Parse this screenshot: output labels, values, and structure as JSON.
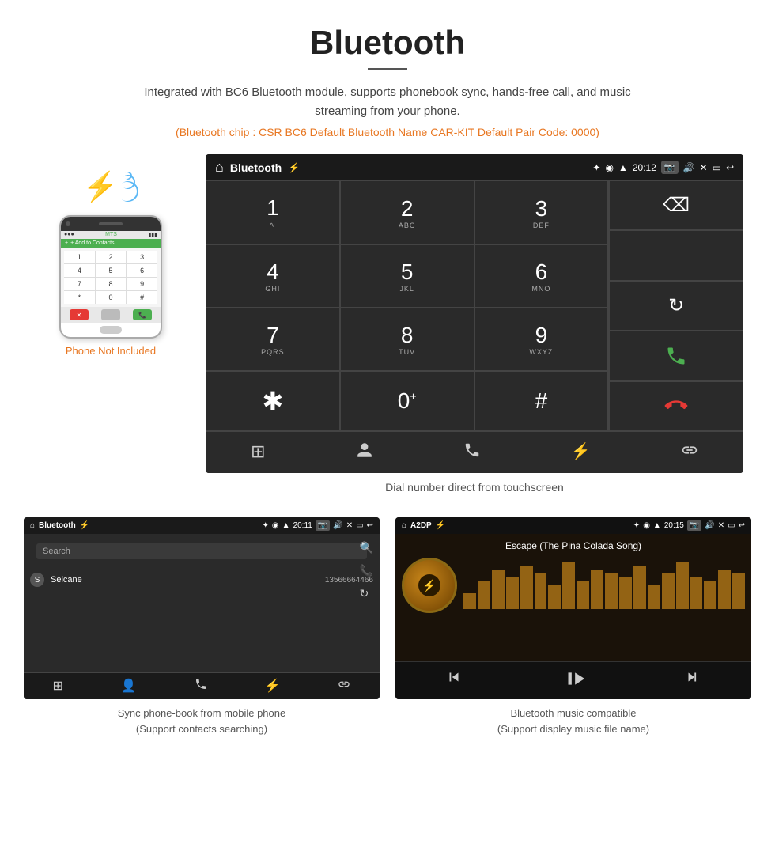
{
  "header": {
    "title": "Bluetooth",
    "description": "Integrated with BC6 Bluetooth module, supports phonebook sync, hands-free call, and music streaming from your phone.",
    "specs": "(Bluetooth chip : CSR BC6    Default Bluetooth Name CAR-KIT    Default Pair Code: 0000)"
  },
  "dial_screen": {
    "status_bar": {
      "home_icon": "⌂",
      "title": "Bluetooth",
      "usb_icon": "⚡",
      "bt_icon": "✦",
      "location_icon": "◉",
      "signal_icon": "▲",
      "time": "20:12",
      "camera_icon": "📷",
      "volume_icon": "🔊",
      "close_icon": "✕",
      "window_icon": "▭",
      "back_icon": "↩"
    },
    "keypad": [
      {
        "number": "1",
        "sub": "∿"
      },
      {
        "number": "2",
        "sub": "ABC"
      },
      {
        "number": "3",
        "sub": "DEF"
      },
      {
        "number": "4",
        "sub": "GHI"
      },
      {
        "number": "5",
        "sub": "JKL"
      },
      {
        "number": "6",
        "sub": "MNO"
      },
      {
        "number": "7",
        "sub": "PQRS"
      },
      {
        "number": "8",
        "sub": "TUV"
      },
      {
        "number": "9",
        "sub": "WXYZ"
      },
      {
        "number": "*",
        "sub": ""
      },
      {
        "number": "0",
        "sub": "+"
      },
      {
        "number": "#",
        "sub": ""
      }
    ],
    "right_panel": {
      "backspace": "⌫",
      "refresh": "↻",
      "call_green": "📞",
      "call_red": "📞"
    },
    "bottom_bar": {
      "grid_icon": "⊞",
      "person_icon": "👤",
      "phone_icon": "📞",
      "bt_icon": "✦",
      "link_icon": "🔗"
    }
  },
  "dial_caption": "Dial number direct from touchscreen",
  "phone": {
    "not_included": "Phone Not Included",
    "add_contact": "+ Add to Contacts",
    "keys": [
      "1",
      "2",
      "3",
      "4",
      "5",
      "6",
      "7",
      "8",
      "9",
      "*",
      "0",
      "#"
    ]
  },
  "phonebook_screen": {
    "title": "Bluetooth",
    "time": "20:11",
    "search_placeholder": "Search",
    "contact": {
      "letter": "S",
      "name": "Seicane",
      "phone": "13566664466"
    }
  },
  "music_screen": {
    "title": "A2DP",
    "time": "20:15",
    "song_title": "Escape (The Pina Colada Song)",
    "eq_bars": [
      20,
      35,
      50,
      40,
      55,
      45,
      30,
      60,
      35,
      50,
      45,
      40,
      55,
      30,
      45,
      60,
      40,
      35,
      50,
      45
    ]
  },
  "bottom_captions": {
    "phonebook": "Sync phone-book from mobile phone\n(Support contacts searching)",
    "music": "Bluetooth music compatible\n(Support display music file name)"
  },
  "colors": {
    "orange": "#e87722",
    "blue": "#4a90d9",
    "green": "#4caf50",
    "red": "#e53935",
    "dark_bg": "#2a2a2a",
    "darker_bg": "#1a1a1a"
  }
}
